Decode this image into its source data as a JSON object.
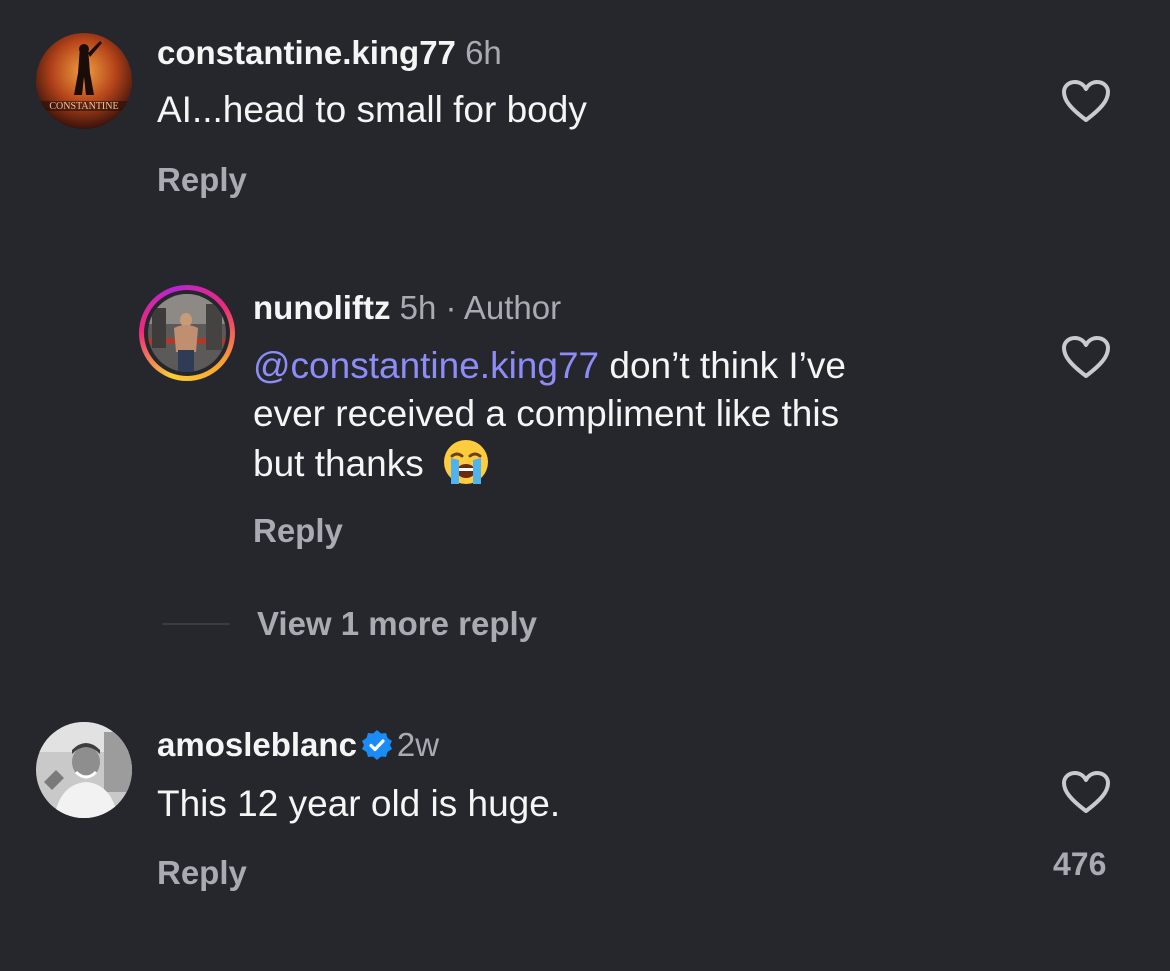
{
  "comments": [
    {
      "username": "constantine.king77",
      "time": "6h",
      "text": "AI...head to small for body",
      "reply_label": "Reply",
      "avatar_text": "CONSTANTINE"
    },
    {
      "username": "nunoliftz",
      "time": "5h",
      "author_tag": "· Author",
      "mention": "@constantine.king77",
      "text_line1": " don’t think I’ve",
      "text_line2": "ever received a compliment like this",
      "text_line3": "but thanks ",
      "emoji": "loudly-crying-face",
      "reply_label": "Reply"
    },
    {
      "username": "amosleblanc",
      "verified": true,
      "time": "2w",
      "text": "This 12 year old is huge.",
      "reply_label": "Reply",
      "like_count": "476"
    }
  ],
  "view_more_label": "View 1 more reply",
  "icons": {
    "like": "heart-outline-icon",
    "verified": "verified-badge-icon"
  },
  "colors": {
    "background": "#25272d",
    "mention": "#8e8cf7",
    "muted": "#a8abb2",
    "verified": "#1a8cf5"
  }
}
